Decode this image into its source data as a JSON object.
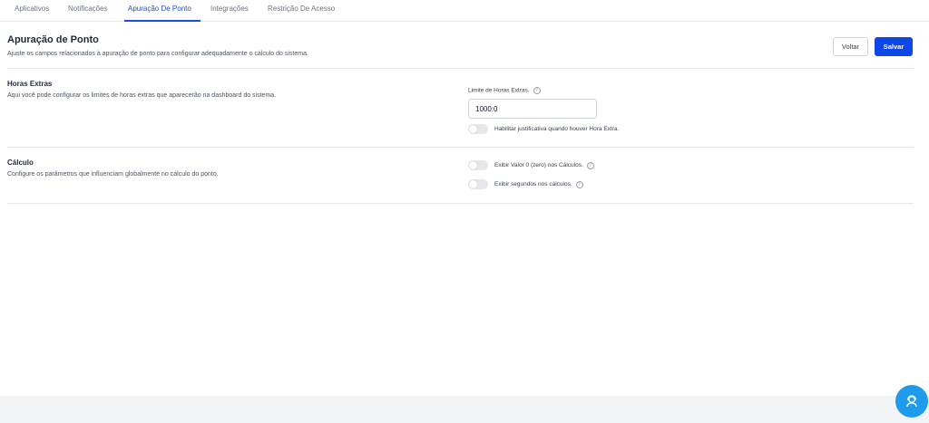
{
  "tabs": [
    {
      "label": "Aplicativos",
      "active": false
    },
    {
      "label": "Notificações",
      "active": false
    },
    {
      "label": "Apuração De Ponto",
      "active": true
    },
    {
      "label": "Integrações",
      "active": false
    },
    {
      "label": "Restrição De Acesso",
      "active": false
    }
  ],
  "header": {
    "title": "Apuração de Ponto",
    "subtitle": "Ajuste os campos relacionados à apuração de ponto para configurar adequadamente o cálculo do sistema.",
    "back_label": "Voltar",
    "save_label": "Salvar"
  },
  "horas_extras": {
    "title": "Horas Extras",
    "description": "Aqui você pode configurar os limites de horas extras que aparecerão na dashboard do sistema.",
    "limit_label": "Limite de Horas Extras.",
    "limit_value": "1000:0",
    "toggle_label": "Habilitar justificativa quando houver Hora Extra.",
    "toggle_on": false
  },
  "calculo": {
    "title": "Cálculo",
    "description": "Configure os parâmetros que influenciam globalmente no cálculo do ponto.",
    "toggle_zero_label": "Exibir Valor 0 (zero) nos Cálculos.",
    "toggle_zero_on": false,
    "toggle_seconds_label": "Exibir segundos nos cálculos.",
    "toggle_seconds_on": false
  },
  "icons": {
    "help": "help-circle-icon",
    "support": "support-agent-icon"
  },
  "colors": {
    "primary": "#0d47e8",
    "active_tab": "#1d4ed8",
    "fab": "#1e9bea"
  }
}
